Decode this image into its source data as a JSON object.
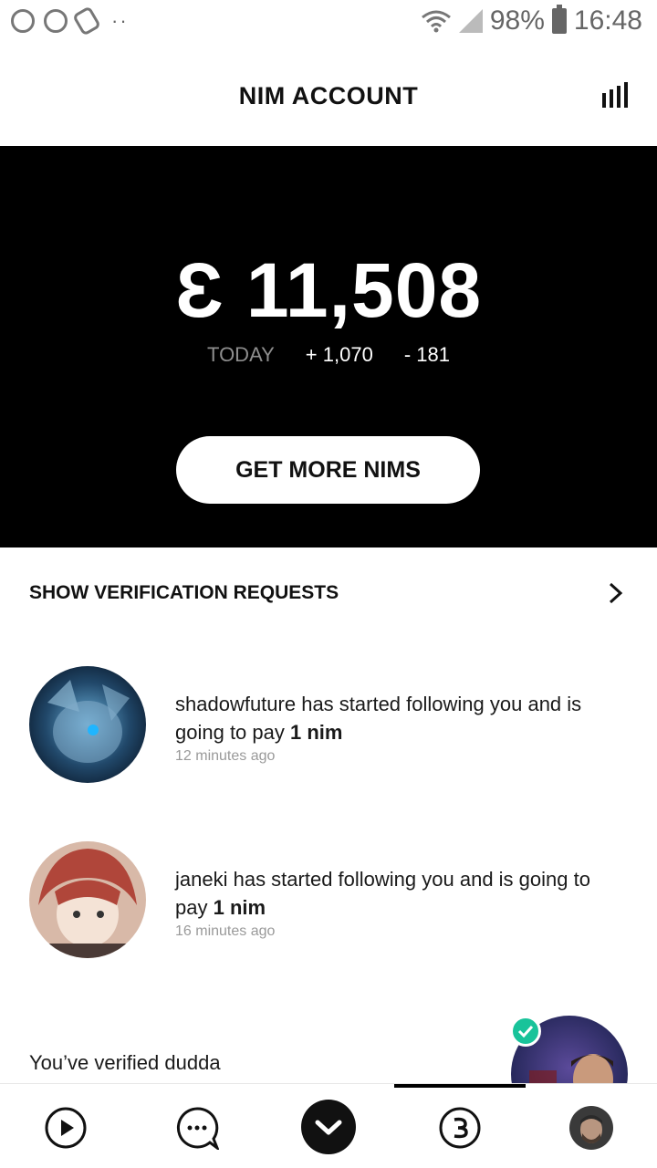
{
  "status_bar": {
    "battery": "98%",
    "time": "16:48"
  },
  "header": {
    "title": "NIM ACCOUNT"
  },
  "balance": {
    "amount": "Ɛ 11,508",
    "today_label": "TODAY",
    "today_in": "+ 1,070",
    "today_out": "- 181"
  },
  "cta": {
    "label": "GET MORE NIMS"
  },
  "verification": {
    "label": "SHOW VERIFICATION REQUESTS"
  },
  "feed": [
    {
      "username": "shadowfuture",
      "text_before": " has started following you and is going to pay ",
      "amount": "1 nim",
      "time": "12 minutes ago"
    },
    {
      "username": "janeki",
      "text_before": " has started following you and is going to pay ",
      "amount": "1 nim",
      "time": "16 minutes ago"
    }
  ],
  "verified": {
    "text": "You’ve verified dudda"
  },
  "nav": {
    "items": [
      "play-icon",
      "chat-icon",
      "home-chevron-icon",
      "nim-currency-icon",
      "profile-avatar"
    ]
  },
  "colors": {
    "hero_bg": "#000000",
    "accent_check": "#18c39a"
  }
}
